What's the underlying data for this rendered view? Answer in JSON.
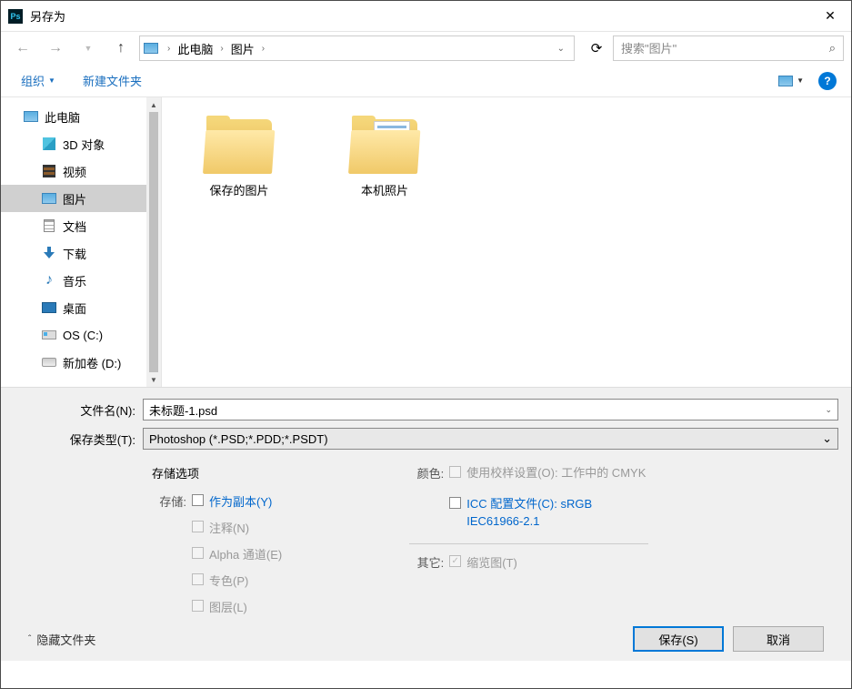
{
  "titlebar": {
    "title": "另存为"
  },
  "nav": {
    "breadcrumb": [
      "此电脑",
      "图片"
    ],
    "search_placeholder": "搜索\"图片\""
  },
  "toolbar": {
    "organize": "组织",
    "new_folder": "新建文件夹"
  },
  "tree": {
    "items": [
      {
        "label": "此电脑",
        "icon": "pc",
        "child": false
      },
      {
        "label": "3D 对象",
        "icon": "3d",
        "child": true
      },
      {
        "label": "视频",
        "icon": "video",
        "child": true
      },
      {
        "label": "图片",
        "icon": "pic",
        "child": true,
        "selected": true
      },
      {
        "label": "文档",
        "icon": "doc",
        "child": true
      },
      {
        "label": "下载",
        "icon": "dl",
        "child": true
      },
      {
        "label": "音乐",
        "icon": "music",
        "child": true
      },
      {
        "label": "桌面",
        "icon": "desktop",
        "child": true
      },
      {
        "label": "OS (C:)",
        "icon": "drive",
        "child": true
      },
      {
        "label": "新加卷 (D:)",
        "icon": "drive2",
        "child": true
      }
    ]
  },
  "content": {
    "folders": [
      {
        "label": "保存的图片",
        "has_paper": false
      },
      {
        "label": "本机照片",
        "has_paper": true
      }
    ]
  },
  "fields": {
    "filename_label": "文件名(N):",
    "filename_value": "未标题-1.psd",
    "type_label": "保存类型(T):",
    "type_value": "Photoshop (*.PSD;*.PDD;*.PSDT)"
  },
  "options": {
    "header": "存储选项",
    "save_label": "存储:",
    "as_copy": "作为副本(Y)",
    "notes": "注释(N)",
    "alpha": "Alpha 通道(E)",
    "spot": "专色(P)",
    "layers": "图层(L)",
    "color_label": "颜色:",
    "proof": "使用校样设置(O):  工作中的 CMYK",
    "icc": "ICC 配置文件(C): sRGB IEC61966-2.1",
    "other_label": "其它:",
    "thumbnail": "缩览图(T)"
  },
  "footer": {
    "hide_folders": "隐藏文件夹",
    "save": "保存(S)",
    "cancel": "取消"
  }
}
